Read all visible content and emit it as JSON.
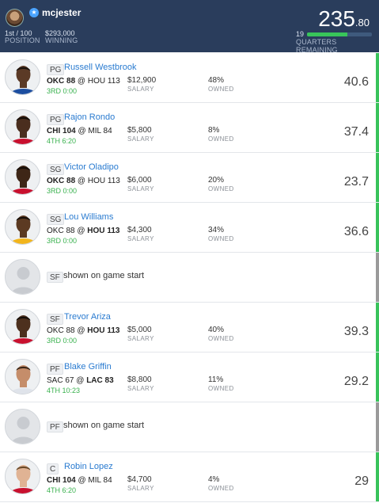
{
  "header": {
    "username": "mcjester",
    "position_value": "1st / 100",
    "position_label": "POSITION",
    "winning_value": "$293,000",
    "winning_label": "WINNING",
    "points_whole": "235",
    "points_decimal": ".80",
    "quarters_value": "19",
    "quarters_label": "QUARTERS REMAINING",
    "quarters_fraction": 0.62,
    "colors": {
      "background": "#2a3d5c",
      "progress": "#38c55a"
    }
  },
  "labels": {
    "salary": "SALARY",
    "owned": "OWNED"
  },
  "players": [
    {
      "pos": "PG",
      "name": "Russell Westbrook",
      "away": "OKC",
      "away_score": "88",
      "home": "HOU",
      "home_score": "113",
      "bold_team": "away",
      "time": "3RD 0:00",
      "salary": "$12,900",
      "owned": "48%",
      "points": "40.6",
      "avatar": "westbrook-photo",
      "stripe": "#39c35b"
    },
    {
      "pos": "PG",
      "name": "Rajon Rondo",
      "away": "CHI",
      "away_score": "104",
      "home": "MIL",
      "home_score": "84",
      "bold_team": "away",
      "time": "4TH 6:20",
      "salary": "$5,800",
      "owned": "8%",
      "points": "37.4",
      "avatar": "rondo-photo",
      "stripe": "#39c35b"
    },
    {
      "pos": "SG",
      "name": "Victor Oladipo",
      "away": "OKC",
      "away_score": "88",
      "home": "HOU",
      "home_score": "113",
      "bold_team": "away",
      "time": "3RD 0:00",
      "salary": "$6,000",
      "owned": "20%",
      "points": "23.7",
      "avatar": "oladipo-photo",
      "stripe": "#39c35b"
    },
    {
      "pos": "SG",
      "name": "Lou Williams",
      "away": "OKC",
      "away_score": "88",
      "home": "HOU",
      "home_score": "113",
      "bold_team": "home",
      "time": "3RD 0:00",
      "salary": "$4,300",
      "owned": "34%",
      "points": "36.6",
      "avatar": "williams-photo",
      "stripe": "#39c35b"
    },
    {
      "pos": "SF",
      "pending": "shown on game start",
      "avatar": "placeholder-avatar",
      "stripe": "#9a9a9a"
    },
    {
      "pos": "SF",
      "name": "Trevor Ariza",
      "away": "OKC",
      "away_score": "88",
      "home": "HOU",
      "home_score": "113",
      "bold_team": "home",
      "time": "3RD 0:00",
      "salary": "$5,000",
      "owned": "40%",
      "points": "39.3",
      "avatar": "ariza-photo",
      "stripe": "#39c35b"
    },
    {
      "pos": "PF",
      "name": "Blake Griffin",
      "away": "SAC",
      "away_score": "67",
      "home": "LAC",
      "home_score": "83",
      "bold_team": "home",
      "time": "4TH 10:23",
      "salary": "$8,800",
      "owned": "11%",
      "points": "29.2",
      "avatar": "griffin-photo",
      "stripe": "#39c35b"
    },
    {
      "pos": "PF",
      "pending": "shown on game start",
      "avatar": "placeholder-avatar",
      "stripe": "#9a9a9a"
    },
    {
      "pos": "C",
      "name": "Robin Lopez",
      "away": "CHI",
      "away_score": "104",
      "home": "MIL",
      "home_score": "84",
      "bold_team": "away",
      "time": "4TH 6:20",
      "salary": "$4,700",
      "owned": "4%",
      "points": "29",
      "avatar": "lopez-photo",
      "stripe": "#39c35b"
    }
  ]
}
